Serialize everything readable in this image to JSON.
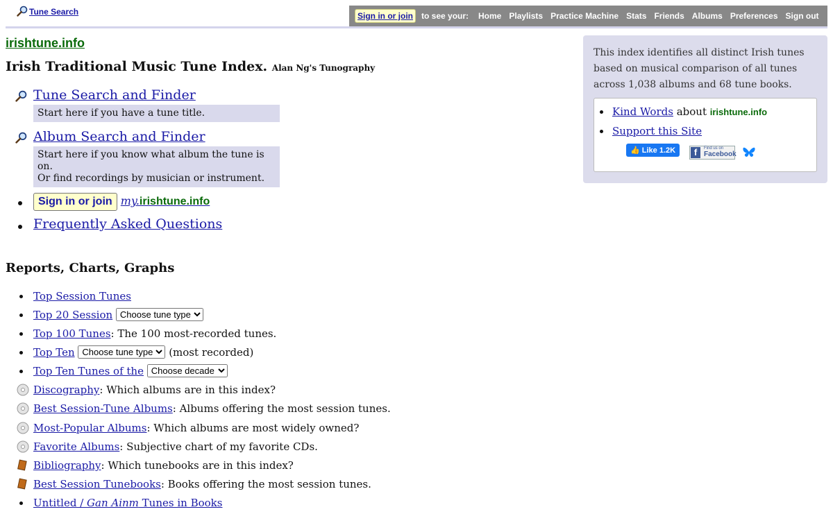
{
  "topbar": {
    "search_link": "Tune Search",
    "sign_in": "Sign in or join",
    "to_see": "to see your:",
    "nav": [
      "Home",
      "Playlists",
      "Practice Machine",
      "Stats",
      "Friends",
      "Albums",
      "Preferences",
      "Sign out"
    ]
  },
  "header": {
    "site": "irishtune.info",
    "title": "Irish Traditional Music Tune Index.",
    "subtitle": "Alan Ng's Tunography"
  },
  "main": {
    "tune_search": "Tune Search and Finder",
    "tune_search_hint": "Start here if you have a tune title.",
    "album_search": "Album Search and Finder",
    "album_search_hint1": "Start here if you know what album the tune is on.",
    "album_search_hint2": "Or find recordings by musician or instrument.",
    "sign_in": "Sign in or join",
    "my_prefix": "my.",
    "my_site": "irishtune.info",
    "faq": "Frequently Asked Questions"
  },
  "info": {
    "text": "This index identifies all distinct Irish tunes based on musical comparison of all tunes across 1,038 albums and 68 tune books.",
    "kind_words": "Kind Words",
    "about": "about",
    "site": "irishtune.info",
    "support": "Support this Site",
    "like": "Like 1.2K",
    "find_us": "Find us on",
    "facebook": "Facebook"
  },
  "reports": {
    "heading": "Reports, Charts, Graphs",
    "top_session": "Top Session Tunes",
    "top20": "Top 20 Session",
    "choose_tune_type": "Choose tune type",
    "top100": "Top 100 Tunes",
    "top100_desc": ": The 100 most-recorded tunes.",
    "top_ten": "Top Ten",
    "most_recorded": "(most recorded)",
    "top_ten_of": "Top Ten Tunes of the",
    "choose_decade": "Choose decade",
    "discography": "Discography",
    "discography_desc": ": Which albums are in this index?",
    "best_albums": "Best Session-Tune Albums",
    "best_albums_desc": ": Albums offering the most session tunes.",
    "popular_albums": "Most-Popular Albums",
    "popular_albums_desc": ": Which albums are most widely owned?",
    "favorite_albums": "Favorite Albums",
    "favorite_albums_desc": ": Subjective chart of my favorite CDs.",
    "bibliography": "Bibliography",
    "bibliography_desc": ": Which tunebooks are in this index?",
    "best_books": "Best Session Tunebooks",
    "best_books_desc": ": Books offering the most session tunes.",
    "untitled_a": "Untitled / ",
    "untitled_b": "Gan Ainm",
    "untitled_c": " Tunes in Books"
  }
}
